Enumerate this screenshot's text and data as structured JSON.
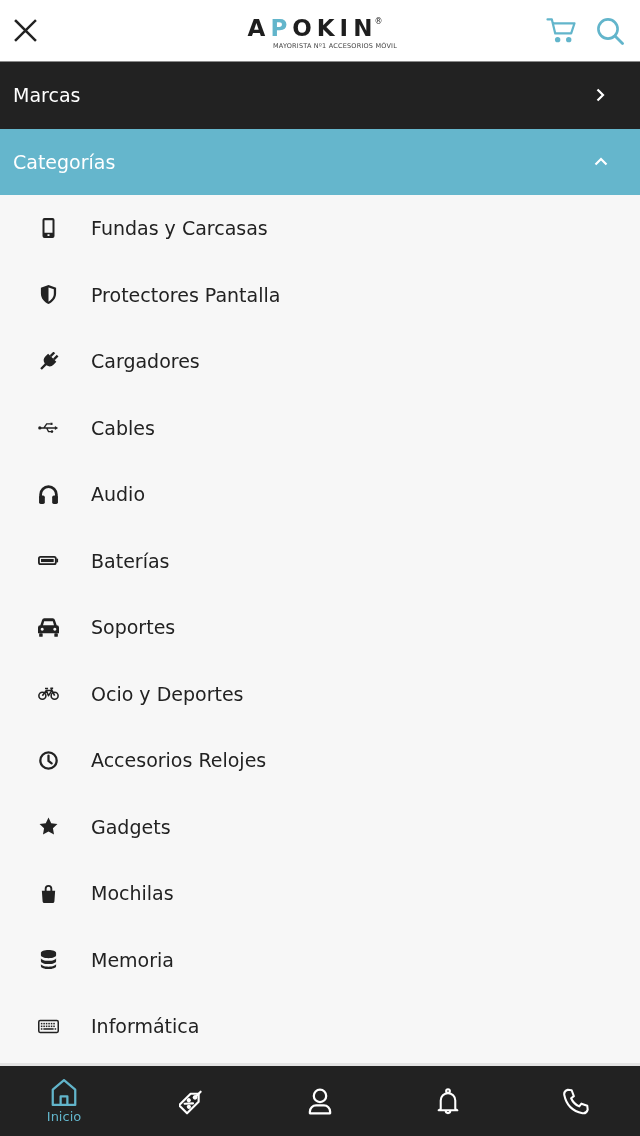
{
  "logo": {
    "wordmark": [
      {
        "text": "A",
        "accent": false
      },
      {
        "text": "P",
        "accent": true
      },
      {
        "text": "OKIN",
        "accent": false
      }
    ],
    "registered": "®",
    "tagline": "MAYORISTA Nº1 ACCESORIOS MÓVIL"
  },
  "menu": {
    "sections": [
      {
        "label": "Marcas",
        "expanded": false
      },
      {
        "label": "Categorías",
        "expanded": true,
        "items": [
          "Fundas y Carcasas",
          "Protectores Pantalla",
          "Cargadores",
          "Cables",
          "Audio",
          "Baterías",
          "Soportes",
          "Ocio y Deportes",
          "Accesorios Relojes",
          "Gadgets",
          "Mochilas",
          "Memoria",
          "Informática"
        ]
      }
    ]
  },
  "bottom_nav": [
    {
      "label": "Inicio",
      "selected": true
    },
    {
      "selected": false
    },
    {
      "selected": false
    },
    {
      "selected": false
    },
    {
      "selected": false
    }
  ]
}
